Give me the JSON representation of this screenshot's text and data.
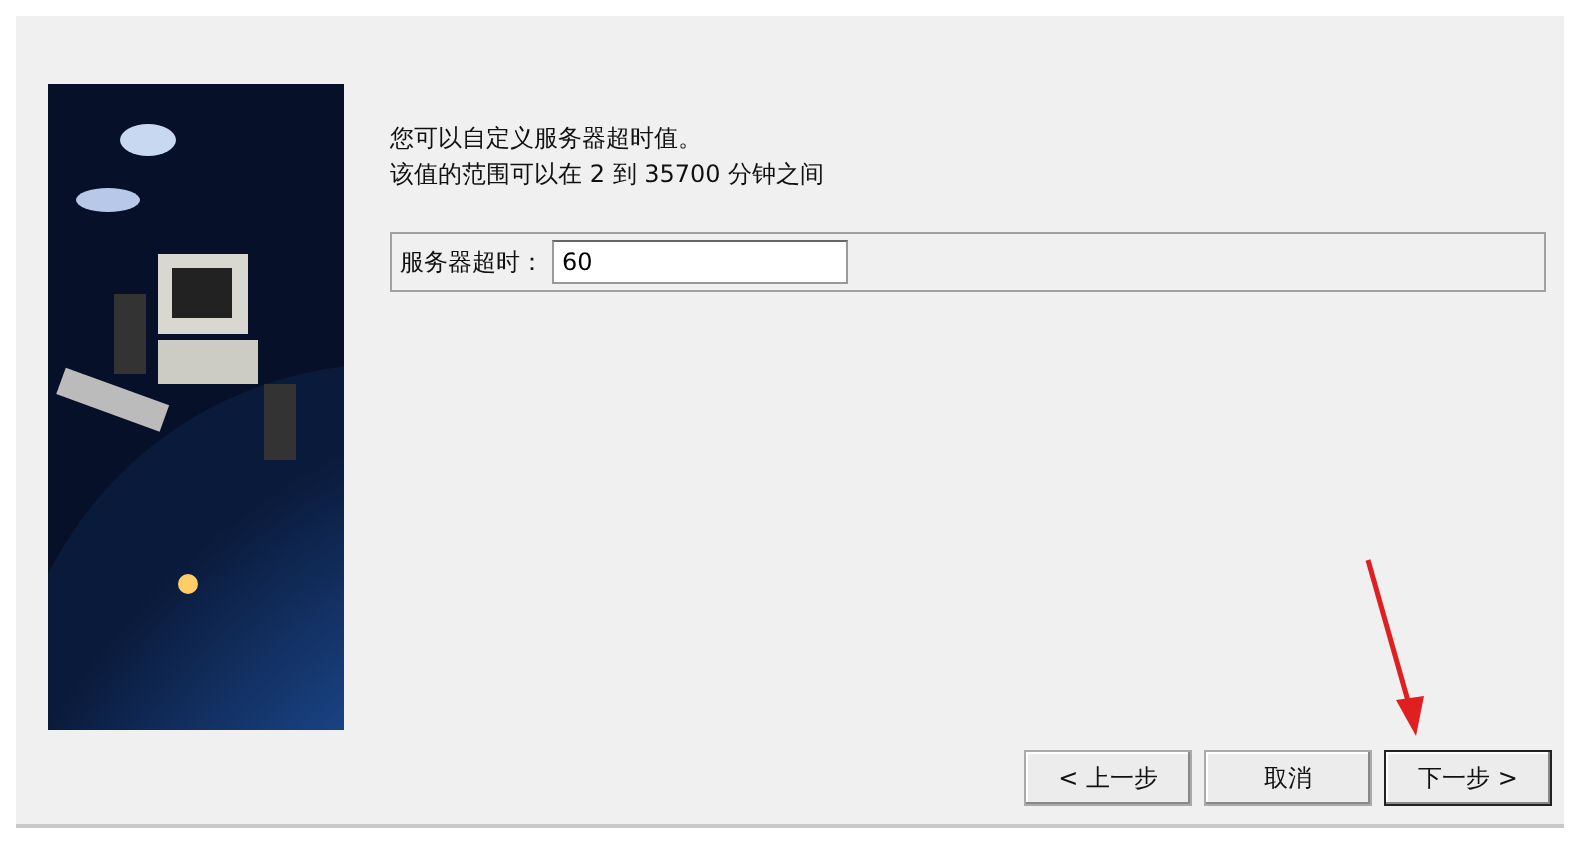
{
  "intro": [
    "您可以自定义服务器超时值。",
    "该值的范围可以在 2 到 35700 分钟之间"
  ],
  "timeout_field": {
    "label": "服务器超时：",
    "value": "60"
  },
  "buttons": [
    {
      "label": "< 上一步",
      "default": false
    },
    {
      "label": "取消",
      "default": false
    },
    {
      "label": "下一步 >",
      "default": true
    }
  ]
}
